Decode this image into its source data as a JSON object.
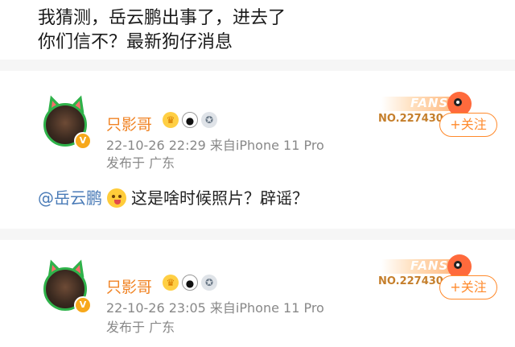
{
  "post": {
    "line1": "我猜测，岳云鹏出事了，进去了",
    "line2": "你们信不？最新狗仔消息"
  },
  "comments": [
    {
      "username": "只影哥",
      "badges": [
        "crown-badge",
        "panda-badge",
        "medal-badge"
      ],
      "timestamp": "22-10-26 22:29",
      "source": "来自iPhone 11 Pro",
      "location": "发布于 广东",
      "fans_label": "FANS",
      "fans_no": "NO.227430",
      "follow_label": "+关注",
      "mention": "@岳云鹏",
      "text": "这是啥时候照片？辟谣？"
    },
    {
      "username": "只影哥",
      "badges": [
        "crown-badge",
        "panda-badge",
        "medal-badge"
      ],
      "timestamp": "22-10-26 23:05",
      "source": "来自iPhone 11 Pro",
      "location": "发布于 广东",
      "fans_label": "FANS",
      "fans_no": "NO.227430",
      "follow_label": "+关注"
    }
  ],
  "colors": {
    "username": "#f08324",
    "mention": "#4a7bb7",
    "follow": "#ff8a2c",
    "meta": "#888888"
  }
}
